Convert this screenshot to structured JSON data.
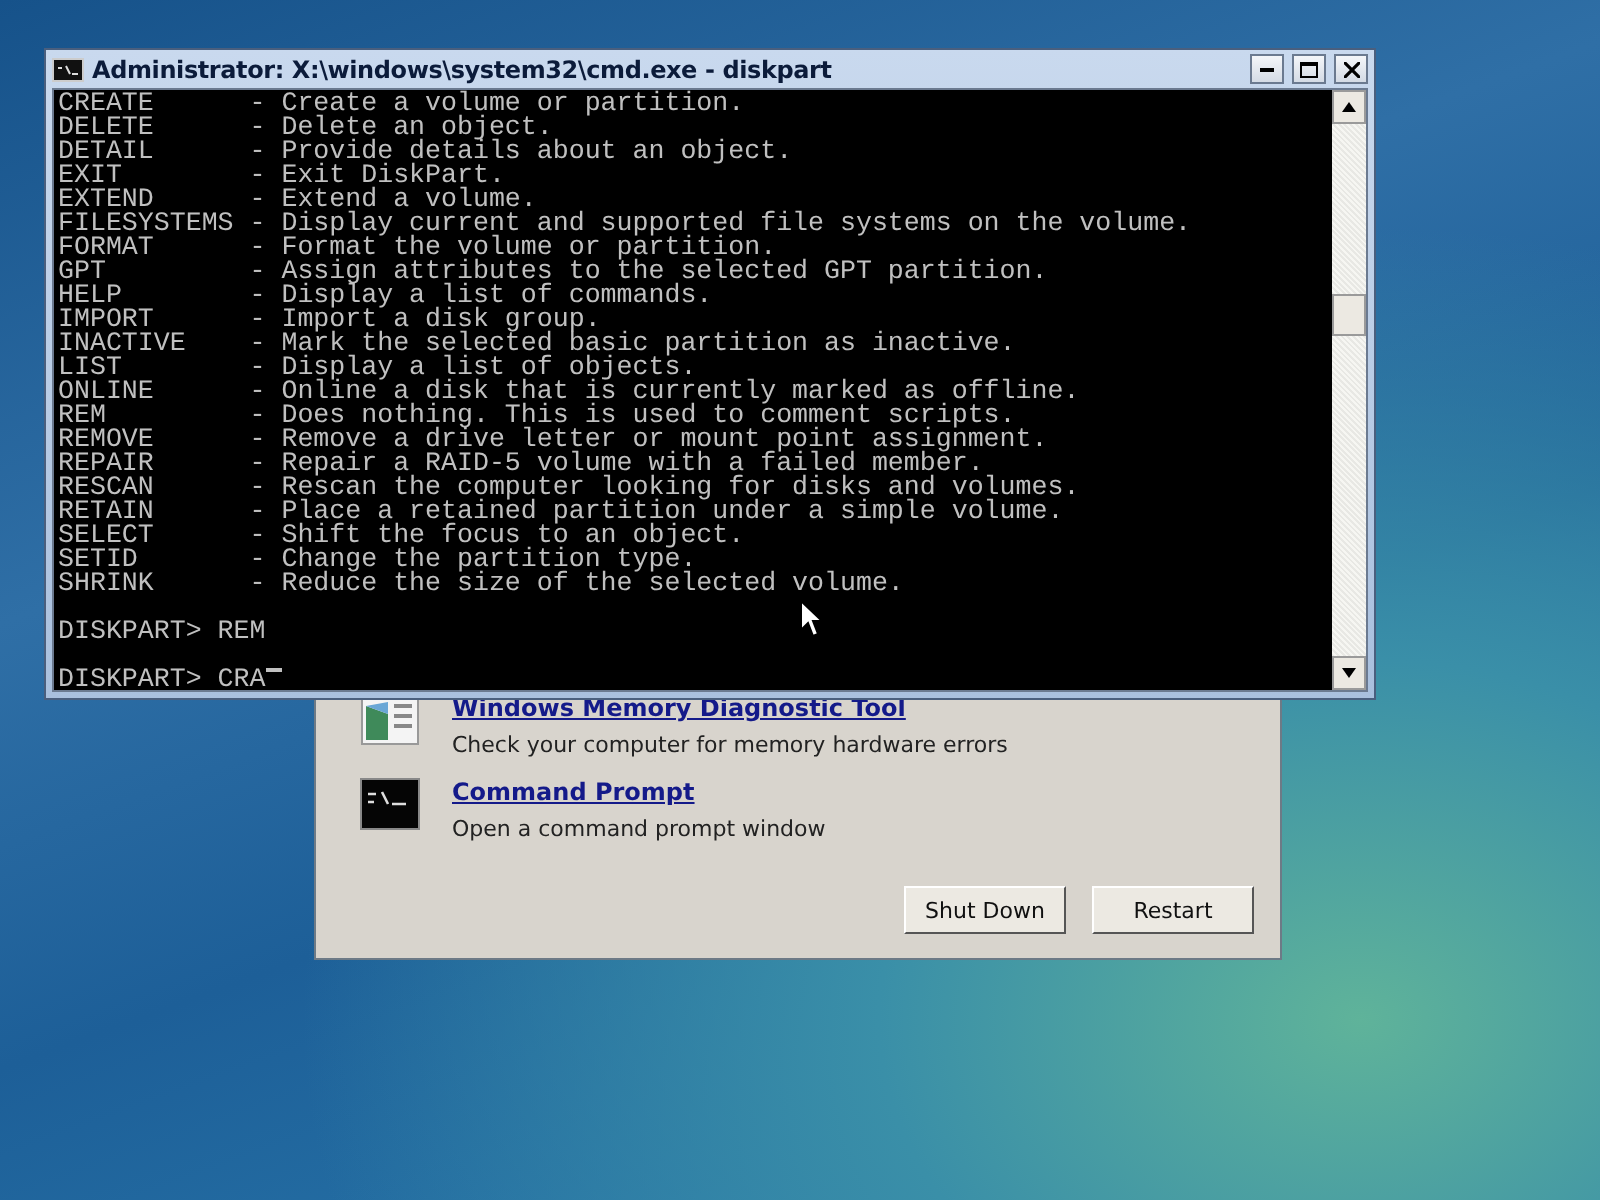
{
  "cmd_window": {
    "title": "Administrator: X:\\windows\\system32\\cmd.exe - diskpart",
    "lines": [
      {
        "command": "CREATE",
        "description": "- Create a volume or partition."
      },
      {
        "command": "DELETE",
        "description": "- Delete an object."
      },
      {
        "command": "DETAIL",
        "description": "- Provide details about an object."
      },
      {
        "command": "EXIT",
        "description": "- Exit DiskPart."
      },
      {
        "command": "EXTEND",
        "description": "- Extend a volume."
      },
      {
        "command": "FILESYSTEMS",
        "description": "- Display current and supported file systems on the volume."
      },
      {
        "command": "FORMAT",
        "description": "- Format the volume or partition."
      },
      {
        "command": "GPT",
        "description": "- Assign attributes to the selected GPT partition."
      },
      {
        "command": "HELP",
        "description": "- Display a list of commands."
      },
      {
        "command": "IMPORT",
        "description": "- Import a disk group."
      },
      {
        "command": "INACTIVE",
        "description": "- Mark the selected basic partition as inactive."
      },
      {
        "command": "LIST",
        "description": "- Display a list of objects."
      },
      {
        "command": "ONLINE",
        "description": "- Online a disk that is currently marked as offline."
      },
      {
        "command": "REM",
        "description": "- Does nothing. This is used to comment scripts."
      },
      {
        "command": "REMOVE",
        "description": "- Remove a drive letter or mount point assignment."
      },
      {
        "command": "REPAIR",
        "description": "- Repair a RAID-5 volume with a failed member."
      },
      {
        "command": "RESCAN",
        "description": "- Rescan the computer looking for disks and volumes."
      },
      {
        "command": "RETAIN",
        "description": "- Place a retained partition under a simple volume."
      },
      {
        "command": "SELECT",
        "description": "- Shift the focus to an object."
      },
      {
        "command": "SETID",
        "description": "- Change the partition type."
      },
      {
        "command": "SHRINK",
        "description": "- Reduce the size of the selected volume."
      }
    ],
    "prompts": [
      "DISKPART> REM",
      "DISKPART> CRA"
    ]
  },
  "recovery_dialog": {
    "items": [
      {
        "kind": "memory",
        "title": "Windows Memory Diagnostic Tool",
        "description": "Check your computer for memory hardware errors"
      },
      {
        "kind": "console",
        "title": "Command Prompt",
        "description": "Open a command prompt window"
      }
    ],
    "buttons": [
      "Shut Down",
      "Restart"
    ]
  }
}
